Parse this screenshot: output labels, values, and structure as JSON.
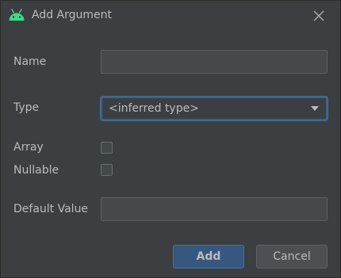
{
  "window": {
    "title": "Add Argument",
    "app_icon": "android-icon",
    "close_icon": "close-icon"
  },
  "form": {
    "name_label": "Name",
    "name_value": "",
    "type_label": "Type",
    "type_value": "<inferred type>",
    "array_label": "Array",
    "array_checked": false,
    "nullable_label": "Nullable",
    "nullable_checked": false,
    "default_label": "Default Value",
    "default_value": ""
  },
  "buttons": {
    "add_label": "Add",
    "cancel_label": "Cancel"
  },
  "colors": {
    "background": "#3c3f41",
    "android_green": "#3ddc84",
    "primary_button": "#365880",
    "focus_border": "#3d6185"
  }
}
